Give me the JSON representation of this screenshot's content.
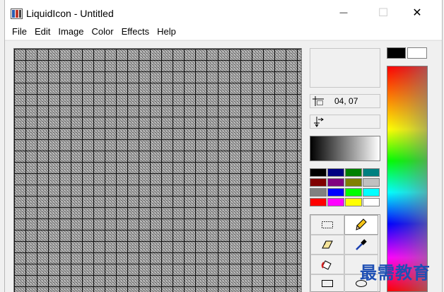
{
  "window": {
    "title": "LiquidIcon - Untitled",
    "controls": {
      "minimize": "—",
      "maximize": "☐",
      "close": "✕"
    }
  },
  "menu": {
    "items": [
      "File",
      "Edit",
      "Image",
      "Color",
      "Effects",
      "Help"
    ]
  },
  "status": {
    "cursor_position": "04, 07",
    "selection_size": ""
  },
  "colors": {
    "foreground": "#000000",
    "background": "#ffffff",
    "palette": [
      "#000000",
      "#000080",
      "#008000",
      "#008080",
      "#800000",
      "#800080",
      "#808000",
      "#c0c0c0",
      "#808080",
      "#0000ff",
      "#00ff00",
      "#00ffff",
      "#ff0000",
      "#ff00ff",
      "#ffff00",
      "#ffffff"
    ]
  },
  "tools": [
    {
      "name": "select-rect",
      "icon": "selection-rectangle-icon",
      "selected": false
    },
    {
      "name": "pencil",
      "icon": "pencil-icon",
      "selected": true
    },
    {
      "name": "eraser",
      "icon": "eraser-icon",
      "selected": false
    },
    {
      "name": "eyedropper",
      "icon": "eyedropper-icon",
      "selected": false
    },
    {
      "name": "fill",
      "icon": "paint-bucket-icon",
      "selected": false
    },
    {
      "name": "blank",
      "icon": "",
      "selected": false
    },
    {
      "name": "rectangle",
      "icon": "rectangle-icon",
      "selected": false
    },
    {
      "name": "ellipse",
      "icon": "ellipse-icon",
      "selected": false
    }
  ],
  "watermark": "最需教育"
}
